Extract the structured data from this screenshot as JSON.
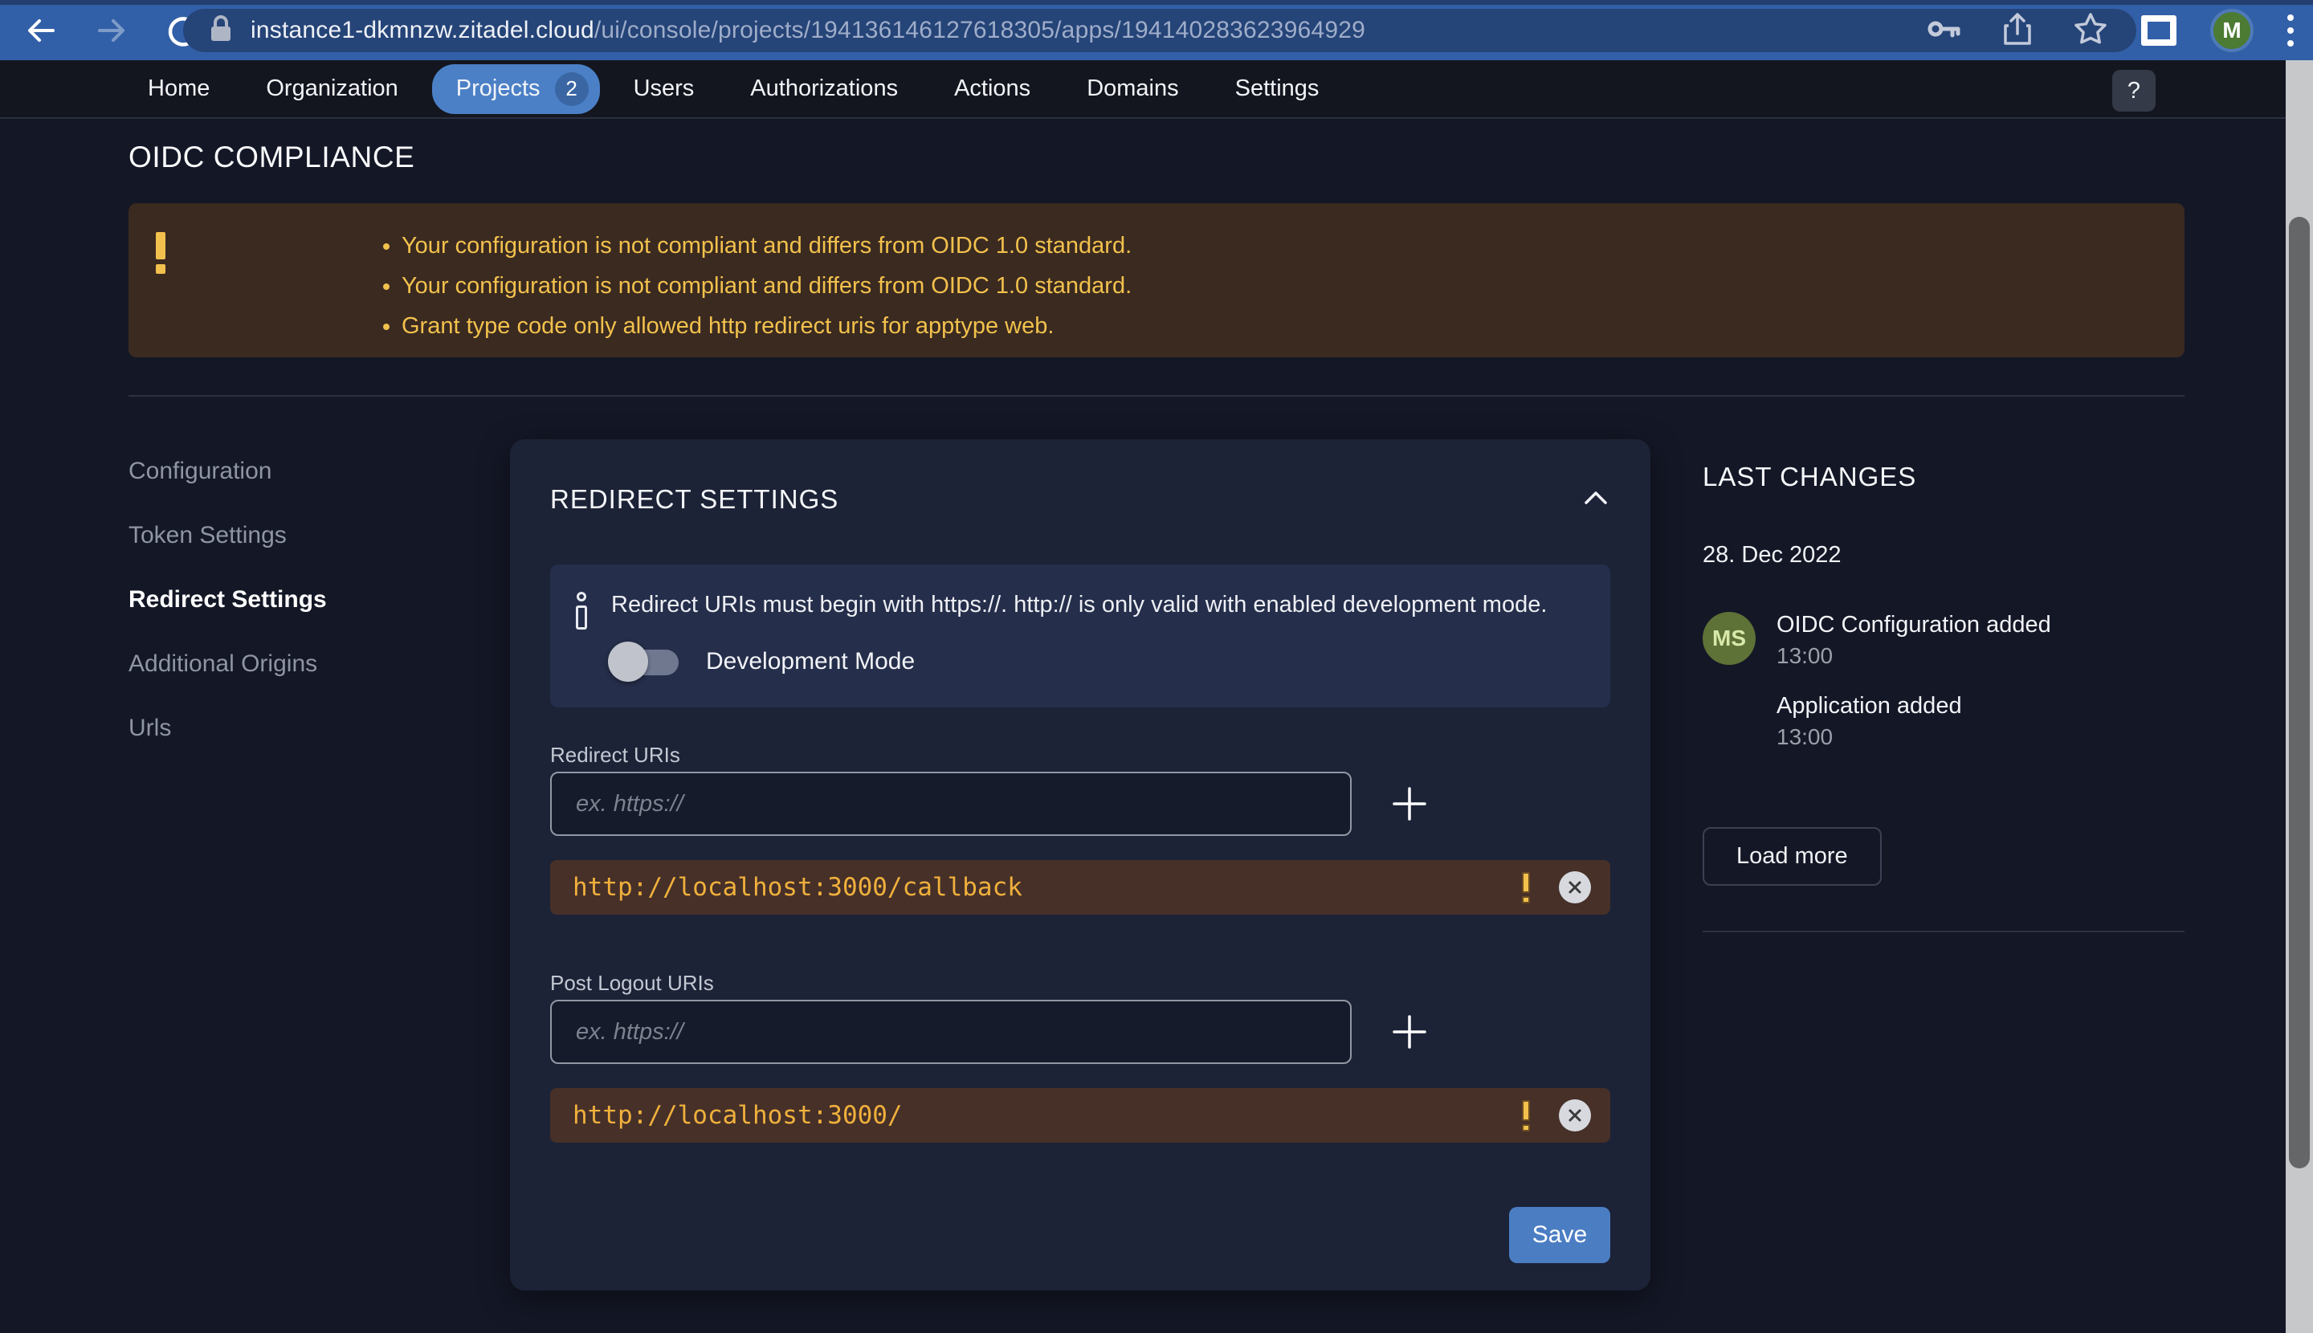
{
  "browser": {
    "url_host": "instance1-dkmnzw.zitadel.cloud",
    "url_path": "/ui/console/projects/194136146127618305/apps/194140283623964929",
    "avatar_letter": "M"
  },
  "nav": {
    "tabs": [
      {
        "label": "Home"
      },
      {
        "label": "Organization"
      },
      {
        "label": "Projects",
        "badge": "2"
      },
      {
        "label": "Users"
      },
      {
        "label": "Authorizations"
      },
      {
        "label": "Actions"
      },
      {
        "label": "Domains"
      },
      {
        "label": "Settings"
      }
    ],
    "help_label": "?"
  },
  "compliance": {
    "title": "OIDC COMPLIANCE",
    "warnings": [
      "Your configuration is not compliant and differs from OIDC 1.0 standard.",
      "Your configuration is not compliant and differs from OIDC 1.0 standard.",
      "Grant type code only allowed http redirect uris for apptype web."
    ]
  },
  "sidebar": {
    "items": [
      {
        "label": "Configuration"
      },
      {
        "label": "Token Settings"
      },
      {
        "label": "Redirect Settings"
      },
      {
        "label": "Additional Origins"
      },
      {
        "label": "Urls"
      }
    ]
  },
  "redirect_settings": {
    "title": "REDIRECT SETTINGS",
    "info_text": "Redirect URIs must begin with https://. http:// is only valid with enabled development mode.",
    "dev_mode_label": "Development Mode",
    "dev_mode_enabled": "false",
    "redirect_uris": {
      "label": "Redirect URIs",
      "placeholder": "ex. https://",
      "items": [
        "http://localhost:3000/callback"
      ]
    },
    "post_logout_uris": {
      "label": "Post Logout URIs",
      "placeholder": "ex. https://",
      "items": [
        "http://localhost:3000/"
      ]
    },
    "save_label": "Save"
  },
  "last_changes": {
    "title": "LAST CHANGES",
    "date": "28. Dec 2022",
    "avatar_initials": "MS",
    "events": [
      {
        "label": "OIDC Configuration added",
        "time": "13:00"
      },
      {
        "label": "Application added",
        "time": "13:00"
      }
    ],
    "load_more_label": "Load more"
  },
  "colors": {
    "accent_blue": "#4b80c7",
    "warning_amber": "#f2c14d",
    "chip_amber": "#f0b03c",
    "chip_brown": "#463028",
    "warn_brown": "#3a2a20",
    "card_bg": "#1c2337",
    "page_bg": "#141726",
    "chrome_blue": "#3260a8"
  }
}
